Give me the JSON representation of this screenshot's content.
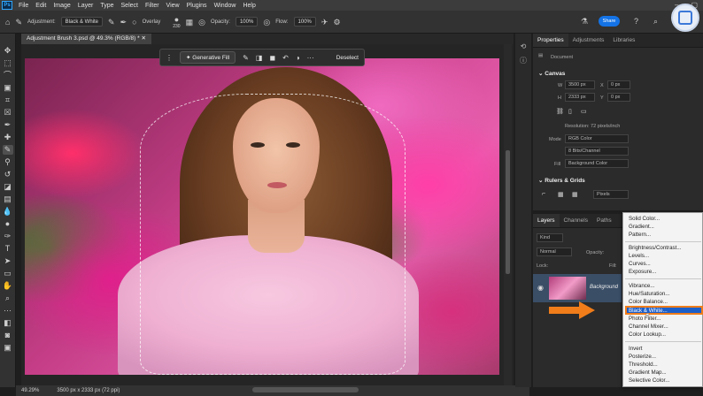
{
  "menubar": {
    "logo": "Ps",
    "items": [
      "File",
      "Edit",
      "Image",
      "Layer",
      "Type",
      "Select",
      "Filter",
      "View",
      "Plugins",
      "Window",
      "Help"
    ]
  },
  "options": {
    "adjustment_label": "Adjustment:",
    "adjustment_value": "Black & White",
    "overlay_label": "Overlay",
    "brush_size": "230",
    "opacity_label": "Opacity:",
    "opacity_value": "100%",
    "flow_label": "Flow:",
    "flow_value": "100%",
    "share_label": "Share"
  },
  "document": {
    "tab_title": "Adjustment Brush 3.psd @ 49.3% (RGB/8) *"
  },
  "context_bar": {
    "generative_fill": "Generative Fill",
    "deselect": "Deselect"
  },
  "status": {
    "zoom": "49.29%",
    "dimensions": "3500 px x 2333 px (72 ppi)"
  },
  "properties": {
    "tabs": [
      "Properties",
      "Adjustments",
      "Libraries"
    ],
    "doc_label": "Document",
    "canvas_header": "Canvas",
    "w_label": "W",
    "w_value": "3500 px",
    "h_label": "H",
    "h_value": "2333 px",
    "x_label": "X",
    "x_value": "0 px",
    "y_label": "Y",
    "y_value": "0 px",
    "resolution": "Resolution: 72 pixels/inch",
    "mode_label": "Mode",
    "mode_value": "RGB Color",
    "bits_value": "8 Bits/Channel",
    "fill_label": "Fill",
    "fill_value": "Background Color",
    "rulers_header": "Rulers & Grids",
    "units_value": "Pixels"
  },
  "layers": {
    "tabs": [
      "Layers",
      "Channels",
      "Paths"
    ],
    "kind": "Kind",
    "normal": "Normal",
    "opacity": "Opacity:",
    "lock": "Lock:",
    "fill": "Fill:",
    "layer_name": "Background"
  },
  "adjust_menu": {
    "group1": [
      "Solid Color...",
      "Gradient...",
      "Pattern..."
    ],
    "group2": [
      "Brightness/Contrast...",
      "Levels...",
      "Curves...",
      "Exposure..."
    ],
    "group3": [
      "Vibrance...",
      "Hue/Saturation...",
      "Color Balance...",
      "Black & White...",
      "Photo Filter...",
      "Channel Mixer...",
      "Color Lookup..."
    ],
    "group4": [
      "Invert",
      "Posterize...",
      "Threshold...",
      "Gradient Map...",
      "Selective Color..."
    ],
    "highlighted": "Black & White...",
    "highlight_color": "#1d5fc9",
    "outline_color": "#f07d1a"
  }
}
